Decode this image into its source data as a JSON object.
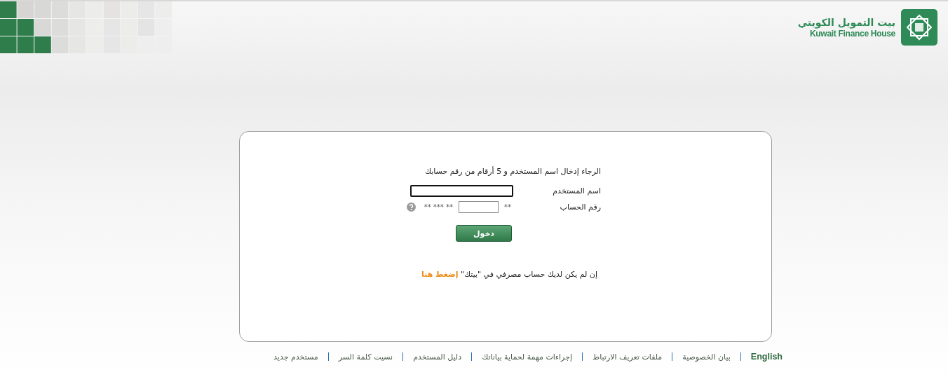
{
  "logo": {
    "arabic_name": "بيت التمويل الكويتي",
    "english_name": "Kuwait Finance House"
  },
  "login": {
    "instruction": "الرجاء إدخال اسم المستخدم و 5 أرقام من رقم حسابك",
    "username": {
      "label": "اسم المستخدم",
      "focused": true
    },
    "account": {
      "label": "رقم الحساب",
      "prefix": "**",
      "suffix": "** *** **"
    },
    "submit": "دخول",
    "signup_text": "إن لم يكن لديك حساب مصرفي في \"بيتك\"",
    "signup_link": "إضغط هنا"
  },
  "footer_links": [
    {
      "label": "English",
      "kind": "language"
    },
    {
      "label": "بيان الخصوصية",
      "kind": "link"
    },
    {
      "label": "ملفات تعريف الارتباط",
      "kind": "link"
    },
    {
      "label": "إجراءات مهمة لحماية بياناتك",
      "kind": "link"
    },
    {
      "label": "دليل المستخدم",
      "kind": "link"
    },
    {
      "label": "نسيت كلمة السر",
      "kind": "link"
    },
    {
      "label": "مستخدم جديد",
      "kind": "link"
    }
  ]
}
